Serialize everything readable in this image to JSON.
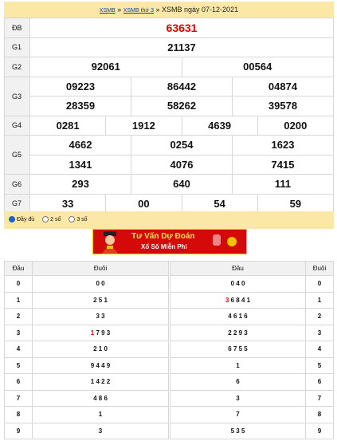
{
  "breadcrumb": {
    "link1": "XSMB",
    "sep1": "»",
    "link2": "XSMB thứ 3",
    "sep2": "»",
    "title": "XSMB ngày 07-12-2021"
  },
  "results": {
    "db": {
      "label": "ĐB",
      "numbers": [
        "63631"
      ]
    },
    "g1": {
      "label": "G1",
      "numbers": [
        "21137"
      ]
    },
    "g2": {
      "label": "G2",
      "numbers": [
        "92061",
        "00564"
      ]
    },
    "g3": {
      "label": "G3",
      "numbers": [
        "09223",
        "86442",
        "04874",
        "28359",
        "58262",
        "39578"
      ]
    },
    "g4": {
      "label": "G4",
      "numbers": [
        "0281",
        "1912",
        "4639",
        "0200"
      ]
    },
    "g5": {
      "label": "G5",
      "numbers": [
        "4662",
        "0254",
        "1623",
        "1341",
        "4076",
        "7415"
      ]
    },
    "g6": {
      "label": "G6",
      "numbers": [
        "293",
        "640",
        "111"
      ]
    },
    "g7": {
      "label": "G7",
      "numbers": [
        "33",
        "00",
        "54",
        "59"
      ]
    }
  },
  "options": {
    "full": "Đầy đủ",
    "two": "2 số",
    "three": "3 số",
    "selected": "full"
  },
  "banner": {
    "line1": "Tư Vấn Dự Đoán",
    "line2": "Xổ Số Miễn Phí"
  },
  "loto_left": {
    "head_key": "Đầu",
    "head_val": "Đuôi",
    "rows": [
      {
        "k": "0",
        "v": "0 0"
      },
      {
        "k": "1",
        "v": "2 5 1"
      },
      {
        "k": "2",
        "v": "3 3"
      },
      {
        "k": "3",
        "v_red": "1",
        "v": "7 9 3"
      },
      {
        "k": "4",
        "v": "2 1 0"
      },
      {
        "k": "5",
        "v": "9 4 4 9"
      },
      {
        "k": "6",
        "v": "1 4 2 2"
      },
      {
        "k": "7",
        "v": "4 8 6"
      },
      {
        "k": "8",
        "v": "1"
      },
      {
        "k": "9",
        "v": "3"
      }
    ]
  },
  "loto_right": {
    "head_val": "Đầu",
    "head_key": "Đuôi",
    "rows": [
      {
        "v": "0 4 0",
        "k": "0"
      },
      {
        "v_red": "3",
        "v": "6 8 4 1",
        "k": "1"
      },
      {
        "v": "4 6 1 6",
        "k": "2"
      },
      {
        "v": "2 2 9 3",
        "k": "3"
      },
      {
        "v": "6 7 5 5",
        "k": "4"
      },
      {
        "v": "1",
        "k": "5"
      },
      {
        "v": "6",
        "k": "6"
      },
      {
        "v": "3",
        "k": "7"
      },
      {
        "v": "7",
        "k": "8"
      },
      {
        "v": "5 3 5",
        "k": "9"
      }
    ]
  },
  "colors": {
    "header_bg": "#fce8a6",
    "special_prize": "#e00000",
    "banner_bg": "#d40a0a"
  }
}
